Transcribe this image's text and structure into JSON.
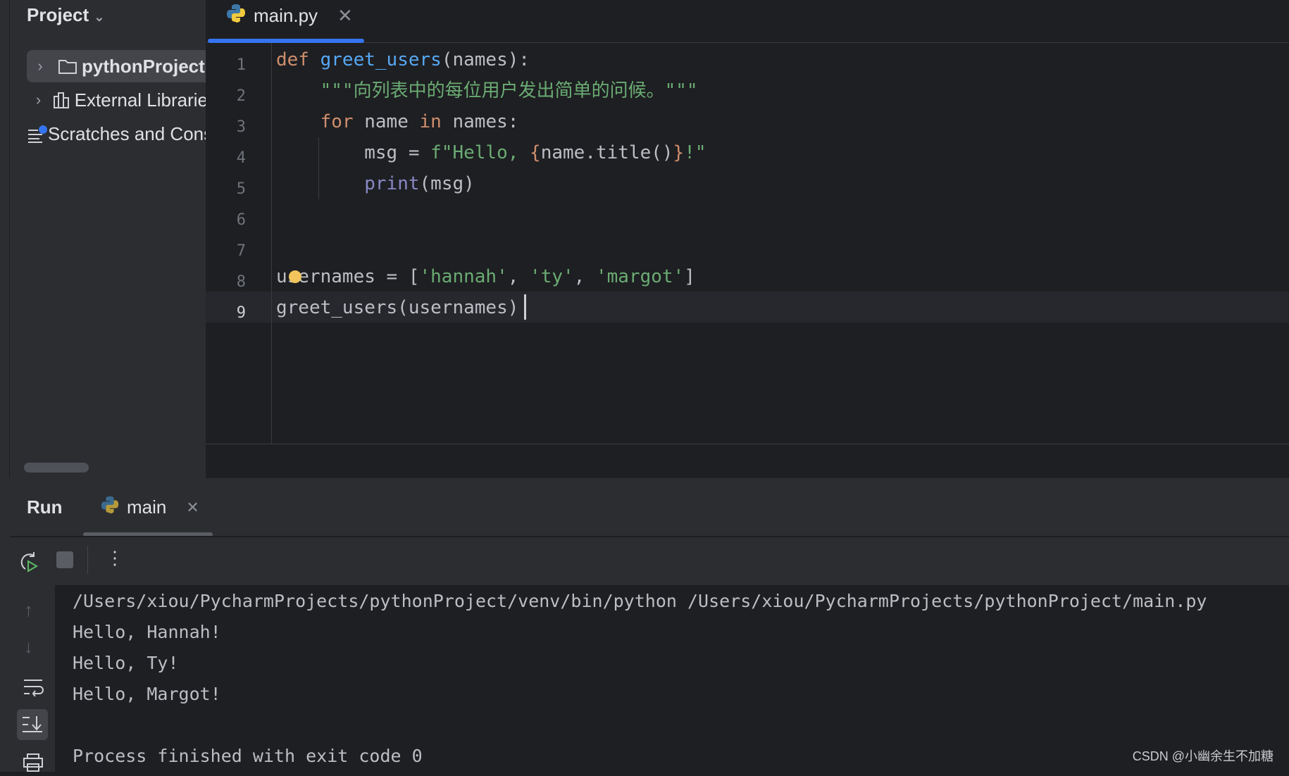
{
  "sidebar": {
    "title": "Project",
    "items": [
      {
        "label": "pythonProject",
        "icon": "folder-icon",
        "expandable": true,
        "selected": true
      },
      {
        "label": "External Libraries",
        "icon": "library-icon",
        "expandable": true
      },
      {
        "label": "Scratches and Consoles",
        "icon": "scratches-icon",
        "expandable": false
      }
    ]
  },
  "editor": {
    "tab": {
      "label": "main.py",
      "icon": "python-icon"
    },
    "line_numbers": [
      "1",
      "2",
      "3",
      "4",
      "5",
      "6",
      "7",
      "8",
      "9"
    ],
    "current_line": 9,
    "lines": [
      [
        {
          "t": "def ",
          "c": "kw"
        },
        {
          "t": "greet_users",
          "c": "fn"
        },
        {
          "t": "(names):",
          "c": ""
        }
      ],
      [
        {
          "t": "    \"\"\"向列表中的每位用户发出简单的问候。\"\"\"",
          "c": "doc"
        }
      ],
      [
        {
          "t": "    ",
          "c": ""
        },
        {
          "t": "for",
          "c": "kw"
        },
        {
          "t": " name ",
          "c": ""
        },
        {
          "t": "in",
          "c": "kw"
        },
        {
          "t": " names:",
          "c": ""
        }
      ],
      [
        {
          "t": "        msg = ",
          "c": ""
        },
        {
          "t": "f\"Hello, ",
          "c": "str"
        },
        {
          "t": "{",
          "c": "br"
        },
        {
          "t": "name.title()",
          "c": ""
        },
        {
          "t": "}",
          "c": "br"
        },
        {
          "t": "!\"",
          "c": "str"
        }
      ],
      [
        {
          "t": "        ",
          "c": ""
        },
        {
          "t": "print",
          "c": "bi"
        },
        {
          "t": "(msg)",
          "c": ""
        }
      ],
      [],
      [],
      [
        {
          "t": "usernames = [",
          "c": ""
        },
        {
          "t": "'hannah'",
          "c": "str"
        },
        {
          "t": ", ",
          "c": ""
        },
        {
          "t": "'ty'",
          "c": "str"
        },
        {
          "t": ", ",
          "c": ""
        },
        {
          "t": "'margot'",
          "c": "str"
        },
        {
          "t": "]",
          "c": ""
        }
      ],
      [
        {
          "t": "greet_users(usernames)",
          "c": ""
        }
      ]
    ]
  },
  "run": {
    "title": "Run",
    "tab": {
      "label": "main",
      "icon": "python-icon"
    },
    "output": [
      "/Users/xiou/PycharmProjects/pythonProject/venv/bin/python /Users/xiou/PycharmProjects/pythonProject/main.py",
      "Hello, Hannah!",
      "Hello, Ty!",
      "Hello, Margot!",
      "",
      "Process finished with exit code 0"
    ]
  },
  "watermark": "CSDN @小幽余生不加糖"
}
